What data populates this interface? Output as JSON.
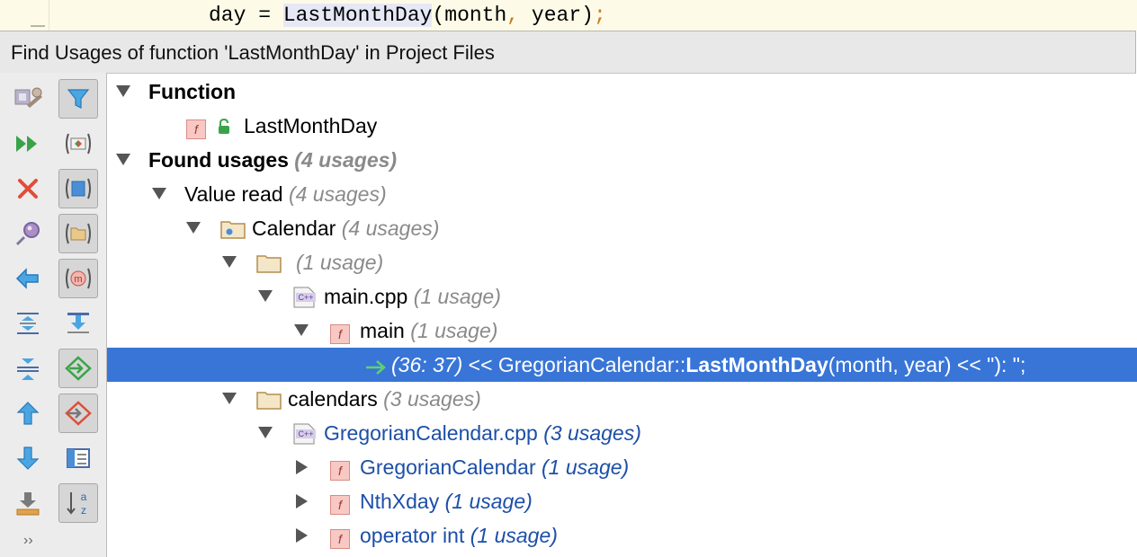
{
  "editor": {
    "indent": "day = ",
    "fn": "LastMonthDay",
    "args": "(month",
    "comma": ",",
    "args2": " year)",
    "semi": ";"
  },
  "header": {
    "title": "Find Usages of function 'LastMonthDay' in Project Files"
  },
  "toolbar": {
    "more": "››",
    "left_icons": [
      "rerun-settings-icon",
      "rerun-icon",
      "close-icon",
      "pin-icon",
      "back-icon",
      "expand-all-icon",
      "collapse-all-icon",
      "previous-occurrence-icon",
      "next-occurrence-icon",
      "export-icon"
    ],
    "right_icons": [
      "filter-icon",
      "group-by-usage-type-icon",
      "group-by-module-icon",
      "group-by-package-icon",
      "group-by-method-icon",
      "scroll-to-source-icon",
      "show-read-access-icon",
      "show-write-access-icon",
      "preview-icon",
      "sort-alphabetically-icon"
    ]
  },
  "tree": {
    "function_label": "Function",
    "function_name": "LastMonthDay",
    "found_label": "Found usages",
    "found_count": "(4 usages)",
    "value_read": "Value read",
    "value_read_count": "(4 usages)",
    "calendar": "Calendar",
    "calendar_count": "(4 usages)",
    "unnamed_dir_count": "(1 usage)",
    "main_cpp": "main.cpp",
    "main_cpp_count": "(1 usage)",
    "main_fn": "main",
    "main_fn_count": "(1 usage)",
    "usage_loc": "(36: 37)",
    "usage_pre": " << GregorianCalendar::",
    "usage_fn": "LastMonthDay",
    "usage_post": "(month, year) << \"): \";",
    "calendars": "calendars",
    "calendars_count": "(3 usages)",
    "greg_cpp": "GregorianCalendar.cpp",
    "greg_cpp_count": "(3 usages)",
    "fn1": "GregorianCalendar",
    "fn1_count": "(1 usage)",
    "fn2": "NthXday",
    "fn2_count": "(1 usage)",
    "fn3": "operator int",
    "fn3_count": "(1 usage)",
    "fbadge": "f",
    "cpp_badge": "C++"
  },
  "colors": {
    "selection": "#3875d7",
    "link_blue": "#1c4fa8",
    "count_gray": "#8a8a8a"
  }
}
